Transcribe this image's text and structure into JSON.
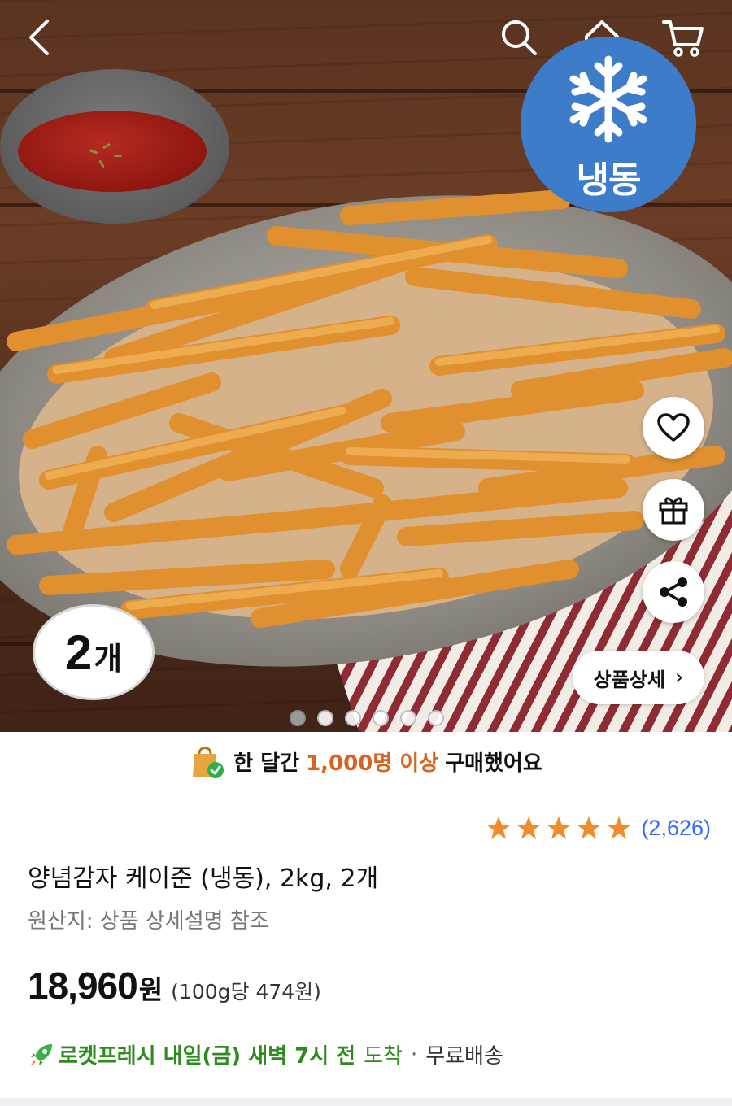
{
  "nav": {
    "back_icon": "chevron-left-icon",
    "search_icon": "search-icon",
    "home_icon": "home-icon",
    "cart_icon": "cart-icon"
  },
  "hero": {
    "frozen_label": "냉동",
    "quantity_number": "2",
    "quantity_unit": "개",
    "detail_button_label": "상품상세",
    "detail_button_chevron": "›",
    "carousel_total": 6,
    "carousel_active": 0
  },
  "actions": {
    "wishlist_icon": "heart-icon",
    "gift_icon": "gift-icon",
    "share_icon": "share-icon"
  },
  "purchase": {
    "prefix": "한 달간",
    "highlight": "1,000명 이상",
    "suffix": "구매했어요"
  },
  "rating": {
    "stars": 5,
    "count": "(2,626)"
  },
  "product": {
    "title": "양념감자 케이준 (냉동), 2kg, 2개",
    "origin": "원산지: 상품 상세설명 참조",
    "price": "18,960",
    "currency": "원",
    "unit_price": "(100g당 474원)"
  },
  "delivery": {
    "rocket_label": "로켓프레시 내일(금) 새벽 7시 전",
    "arrival": "도착",
    "separator": "·",
    "shipping": "무료배송"
  },
  "colors": {
    "accent_orange": "#d9631e",
    "link_blue": "#346aff",
    "delivery_green": "#2e8b1e",
    "frozen_blue": "#3d7cc9",
    "star_orange": "#f28c28"
  }
}
